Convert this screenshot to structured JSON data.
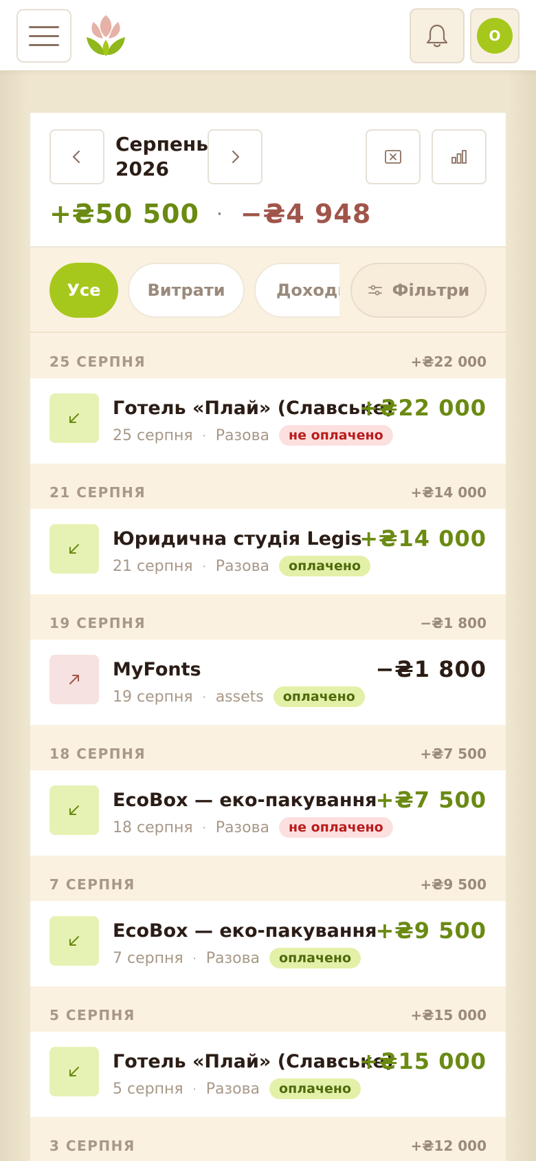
{
  "header": {
    "menu_icon": "hamburger-menu-icon",
    "logo_icon": "lotus-logo-icon",
    "bell_icon": "bell-icon",
    "avatar_initial": "O",
    "colors": {
      "accent": "#a6c81c",
      "income": "#6a8a12",
      "expense": "#a0554a",
      "background": "#efe6cf"
    }
  },
  "summary": {
    "month_line1": "Серпень",
    "month_line2": "2026",
    "prev_icon": "chevron-left-icon",
    "next_icon": "chevron-right-icon",
    "action1_icon": "receipt-x-icon",
    "action2_icon": "bar-chart-icon",
    "income_total": "+₴50 500",
    "separator": "·",
    "expense_total": "−₴4 948"
  },
  "filters": {
    "all": "Усе",
    "expenses": "Витрати",
    "income": "Доходи",
    "filters": "Фільтри",
    "filters_icon": "sliders-icon"
  },
  "groups": [
    {
      "date": "25 СЕРПНЯ",
      "sum": "+₴22 000",
      "tx": {
        "direction": "in",
        "icon": "arrow-down-left-icon",
        "name": "Готель «Плай» (Славське)",
        "amount": "+₴22 000",
        "date": "25 серпня",
        "kind": "Разова",
        "status": "не оплачено"
      }
    },
    {
      "date": "21 СЕРПНЯ",
      "sum": "+₴14 000",
      "tx": {
        "direction": "in",
        "icon": "arrow-down-left-icon",
        "name": "Юридична студія Legis",
        "amount": "+₴14 000",
        "date": "21 серпня",
        "kind": "Разова",
        "status": "оплачено"
      }
    },
    {
      "date": "19 СЕРПНЯ",
      "sum": "−₴1 800",
      "tx": {
        "direction": "out",
        "icon": "arrow-up-right-icon",
        "name": "MyFonts",
        "amount": "−₴1 800",
        "date": "19 серпня",
        "kind": "assets",
        "status": "оплачено"
      }
    },
    {
      "date": "18 СЕРПНЯ",
      "sum": "+₴7 500",
      "tx": {
        "direction": "in",
        "icon": "arrow-down-left-icon",
        "name": "EcoBox — еко-пакування",
        "amount": "+₴7 500",
        "date": "18 серпня",
        "kind": "Разова",
        "status": "не оплачено"
      }
    },
    {
      "date": "7 СЕРПНЯ",
      "sum": "+₴9 500",
      "tx": {
        "direction": "in",
        "icon": "arrow-down-left-icon",
        "name": "EcoBox — еко-пакування",
        "amount": "+₴9 500",
        "date": "7 серпня",
        "kind": "Разова",
        "status": "оплачено"
      }
    },
    {
      "date": "5 СЕРПНЯ",
      "sum": "+₴15 000",
      "tx": {
        "direction": "in",
        "icon": "arrow-down-left-icon",
        "name": "Готель «Плай» (Славське)",
        "amount": "+₴15 000",
        "date": "5 серпня",
        "kind": "Разова",
        "status": "оплачено"
      }
    },
    {
      "date": "3 СЕРПНЯ",
      "sum": "+₴12 000"
    }
  ]
}
